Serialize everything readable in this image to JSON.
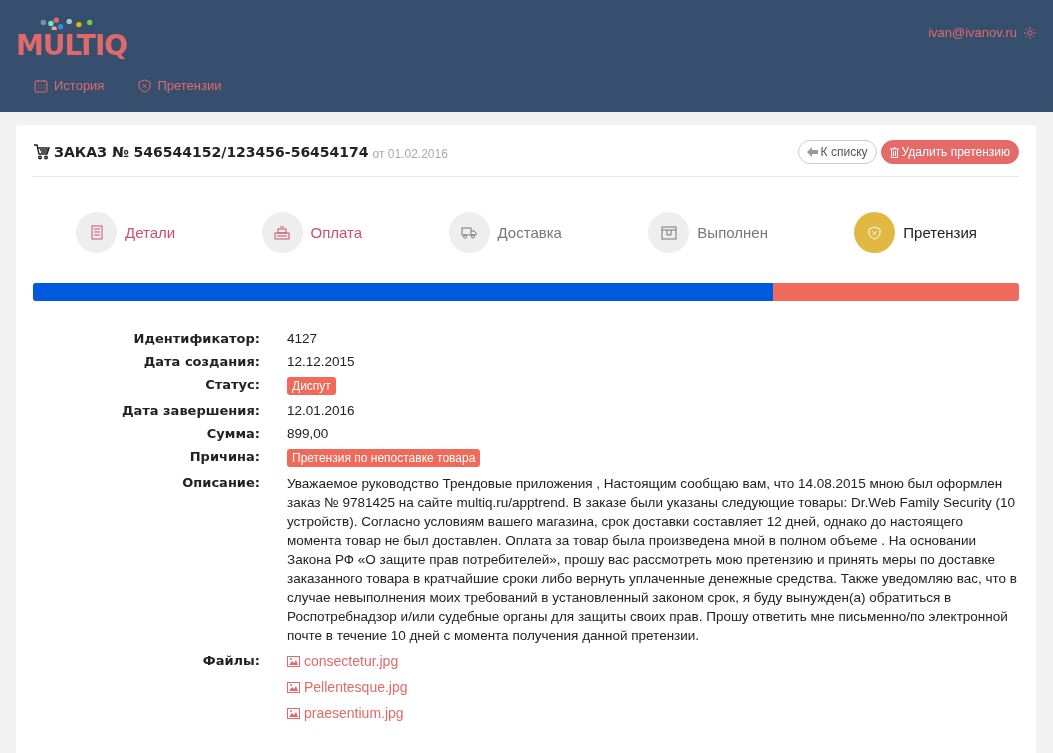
{
  "header": {
    "logo": "MULTIQ",
    "user": "ivan@ivanov.ru",
    "nav": [
      {
        "label": "История"
      },
      {
        "label": "Претензии"
      }
    ]
  },
  "order": {
    "title": "ЗАКАЗ № 546544152/123456-56454174",
    "date": "от 01.02.2016",
    "buttons": [
      {
        "label": "К списку",
        "kind": "back"
      },
      {
        "label": "Удалить претензию",
        "kind": "delete"
      }
    ]
  },
  "steps": [
    {
      "label": "Детали",
      "done": true,
      "selected": false
    },
    {
      "label": "Оплата",
      "done": true,
      "selected": false
    },
    {
      "label": "Доставка",
      "done": false,
      "selected": false
    },
    {
      "label": "Выполнен",
      "done": false,
      "selected": false
    },
    {
      "label": "Претензия",
      "done": false,
      "selected": true
    }
  ],
  "progress": {
    "level": 0.75
  },
  "fields": [
    {
      "label": "Идентификатор:",
      "kind": "text",
      "value": "4127"
    },
    {
      "label": "Дата создания:",
      "kind": "text",
      "value": "12.12.2015"
    },
    {
      "label": "Статус:",
      "kind": "badge",
      "value": "Диспут"
    },
    {
      "label": "Дата завершения:",
      "kind": "text",
      "value": "12.01.2016"
    },
    {
      "label": "Сумма:",
      "kind": "text",
      "value": "899,00"
    },
    {
      "label": "Причина:",
      "kind": "badge",
      "value": "Претензия по непоставке товара"
    },
    {
      "label": "Описание:",
      "kind": "paragraph",
      "value": "Уважаемое руководство Трендовые приложения , Настоящим сообщаю вам, что 14.08.2015 мною был оформлен заказ № 9781425 на сайте multiq.ru/apptrend. В заказе были указаны следующие товары: Dr.Web Family Security (10 устройств). Согласно условиям вашего магазина, срок доставки составляет 12 дней, однако до настоящего момента товар не был доставлен. Оплата за товар была произведена мной в полном объеме . На основании Закона РФ «О защите прав потребителей», прошу вас рассмотреть мою претензию и принять меры по доставке заказанного товара в кратчайшие сроки либо вернуть уплаченные денежные средства. Также уведомляю вас, что в случае невыполнения моих требований в установленный законом срок, я буду вынужден(а) обратиться в Роспотребнадзор и/или судебные органы для защиты своих прав. Прошу ответить мне письменно/по электронной почте в течение 10 дней с момента получения данной претензии."
    },
    {
      "label": "Файлы:",
      "kind": "files",
      "files": [
        "consectetur.jpg",
        "Pellentesque.jpg",
        "praesentium.jpg"
      ]
    }
  ]
}
